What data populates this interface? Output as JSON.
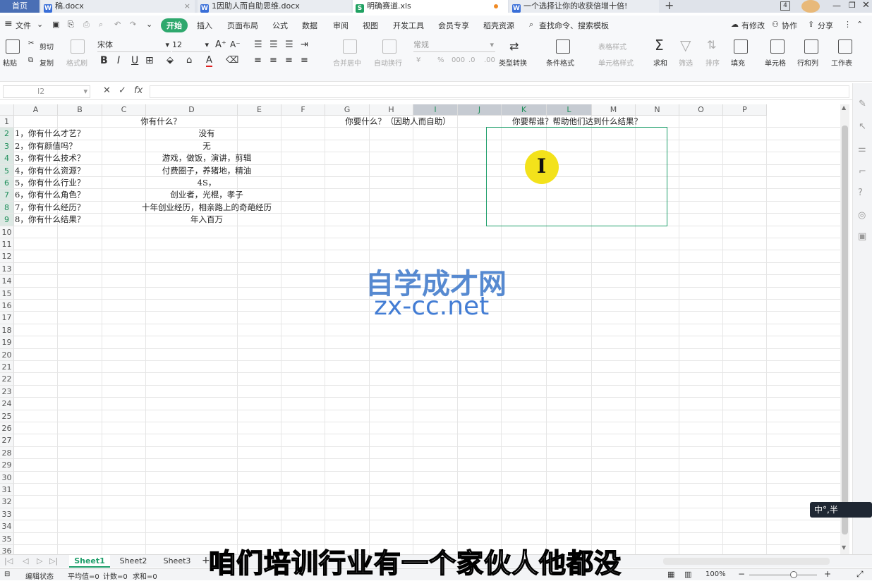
{
  "tabs": [
    {
      "label": "首页",
      "active": true
    },
    {
      "label": "稿.docx"
    },
    {
      "label": "1因助人而自助思维.docx"
    },
    {
      "label": "明确赛道.xls",
      "current": true
    },
    {
      "label": "一个选择让你的收获倍增十倍!"
    }
  ],
  "titlebar": {
    "window_count": "4"
  },
  "menu": {
    "file": "文件",
    "start": "开始",
    "insert": "插入",
    "layout": "页面布局",
    "formula": "公式",
    "data": "数据",
    "review": "审阅",
    "view": "视图",
    "dev": "开发工具",
    "vip": "会员专享",
    "resources": "稻壳资源",
    "search": "查找命令、搜索模板",
    "changes": "有修改",
    "collab": "协作",
    "share": "分享"
  },
  "ribbon": {
    "paste": "粘贴",
    "cut": "剪切",
    "copy": "复制",
    "format_painter": "格式刷",
    "font": "宋体",
    "size": "12",
    "merge": "合并居中",
    "wrap": "自动换行",
    "numfmt": "常规",
    "convert": "类型转换",
    "cond": "条件格式",
    "table_style": "表格样式",
    "cell_style": "单元格样式",
    "sum": "求和",
    "filter": "筛选",
    "sort": "排序",
    "fill": "填充",
    "cell": "单元格",
    "rowcol": "行和列",
    "sheet": "工作表"
  },
  "formula_bar": {
    "namebox": "I2",
    "fx": "fx",
    "value": ""
  },
  "columns": [
    "A",
    "B",
    "C",
    "D",
    "E",
    "F",
    "G",
    "H",
    "I",
    "J",
    "K",
    "L",
    "M",
    "N",
    "O",
    "P"
  ],
  "rows": [
    "1",
    "2",
    "3",
    "4",
    "5",
    "6",
    "7",
    "8",
    "9",
    "10",
    "11",
    "12",
    "13",
    "14",
    "15",
    "16",
    "17",
    "18",
    "19",
    "20",
    "21",
    "22",
    "23",
    "24",
    "25",
    "26",
    "27",
    "28",
    "29",
    "30",
    "31",
    "32",
    "33",
    "34",
    "35",
    "36"
  ],
  "cells": {
    "c1": "你有什么？",
    "e1": "你要什么？（因助人而自助）",
    "i1": "你要帮谁？帮助他们达到什么结果？",
    "a": [
      "1，你有什么才艺？",
      "2，你有颜值吗？",
      "3，你有什么技术？",
      "4，你有什么资源？",
      "5，你有什么行业？",
      "6，你有什么角色？",
      "7，你有什么经历？",
      "8，你有什么结果？"
    ],
    "d": [
      "没有",
      "无",
      "游戏，做饭，演讲，剪辑",
      "付费圈子，养猪地，精油",
      "4S，",
      "创业者，光棍，孝子",
      "十年创业经历，相亲路上的奇葩经历",
      "年入百万"
    ]
  },
  "sheets": [
    "Sheet1",
    "Sheet2",
    "Sheet3"
  ],
  "status": {
    "mode": "编辑状态",
    "avg": "平均值=0",
    "count": "计数=0",
    "sum": "求和=0",
    "zoom": "100%"
  },
  "watermark": {
    "line1": "自学成才网",
    "line2": "zx-cc.net"
  },
  "caption": "咱们培训行业有一个家伙人他都没",
  "ime": "中°,半",
  "colors": {
    "accent": "#1e9e6a",
    "start_btn": "#2ea86d"
  }
}
